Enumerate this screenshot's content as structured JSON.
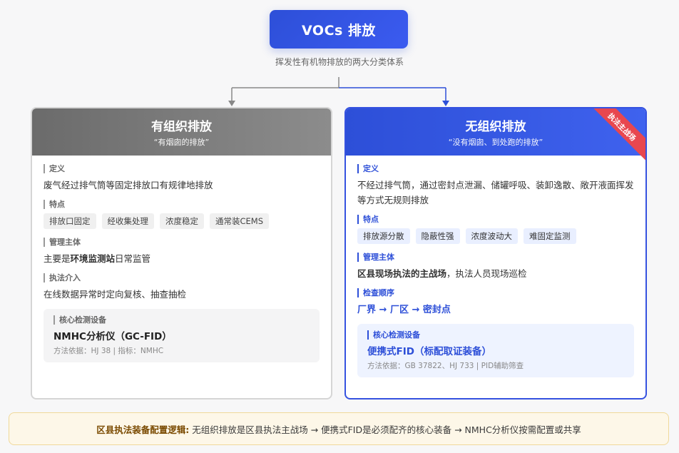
{
  "title": "VOCs 排放",
  "subtitle": "挥发性有机物排放的两大分类体系",
  "left": {
    "title": "有组织排放",
    "subtitle": "“有烟囱的排放”",
    "def_label": "定义",
    "def_text": "废气经过排气筒等固定排放口有规律地排放",
    "feat_label": "特点",
    "tags": [
      "排放口固定",
      "经收集处理",
      "浓度稳定",
      "通常装CEMS"
    ],
    "mgmt_label": "管理主体",
    "mgmt_pre": "主要是",
    "mgmt_bold": "环境监测站",
    "mgmt_post": "日常监管",
    "enf_label": "执法介入",
    "enf_text": "在线数据异常时定向复核、抽查抽检",
    "device_label": "核心检测设备",
    "device_name": "NMHC分析仪（GC-FID）",
    "device_basis": "方法依据：HJ 38 | 指标：NMHC"
  },
  "right": {
    "title": "无组织排放",
    "subtitle": "“没有烟囱、到处跑的排放”",
    "ribbon": "执法主战场",
    "def_label": "定义",
    "def_text": "不经过排气筒，通过密封点泄漏、储罐呼吸、装卸逸散、敞开液面挥发等方式无规则排放",
    "feat_label": "特点",
    "tags": [
      "排放源分散",
      "隐蔽性强",
      "浓度波动大",
      "难固定监测"
    ],
    "mgmt_label": "管理主体",
    "mgmt_bold": "区县现场执法的主战场",
    "mgmt_post": "，执法人员现场巡检",
    "order_label": "检查顺序",
    "order_text": "厂界 → 厂区 → 密封点",
    "device_label": "核心检测设备",
    "device_name": "便携式FID（标配取证装备）",
    "device_basis": "方法依据：GB 37822、HJ 733 | PID辅助筛查"
  },
  "footer": {
    "label": "区县执法装备配置逻辑:",
    "text": "无组织排放是区县执法主战场 → 便携式FID是必须配齐的核心装备 → NMHC分析仪按需配置或共享"
  }
}
